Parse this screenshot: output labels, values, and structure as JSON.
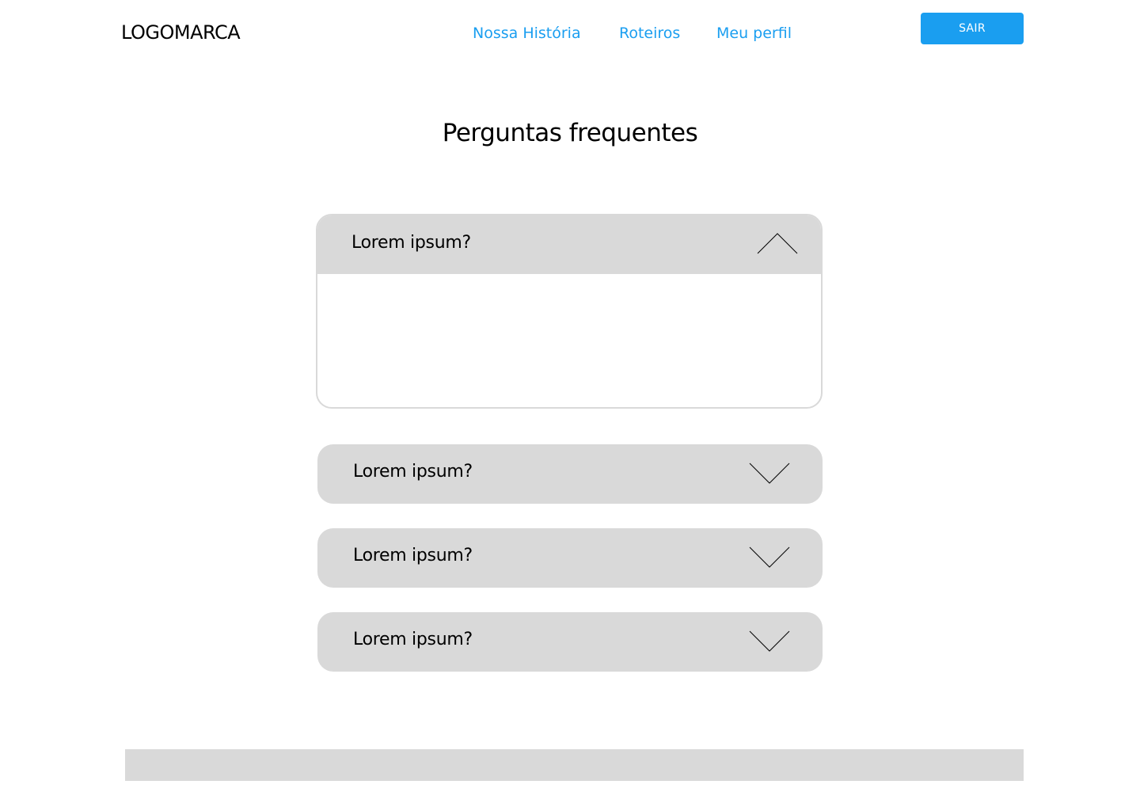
{
  "header": {
    "logo_text": "LOGOMARCA",
    "nav": [
      {
        "label": "Nossa História"
      },
      {
        "label": "Roteiros"
      },
      {
        "label": "Meu perfil"
      }
    ],
    "logout_label": "SAIR"
  },
  "main": {
    "title": "Perguntas frequentes",
    "faq": [
      {
        "question": "Lorem ipsum?",
        "expanded": true,
        "answer": "",
        "icon": "chevron-up-icon"
      },
      {
        "question": "Lorem ipsum?",
        "expanded": false,
        "icon": "chevron-down-icon"
      },
      {
        "question": "Lorem ipsum?",
        "expanded": false,
        "icon": "chevron-down-icon"
      },
      {
        "question": "Lorem ipsum?",
        "expanded": false,
        "icon": "chevron-down-icon"
      }
    ]
  },
  "colors": {
    "accent": "#1a9ef0",
    "panel": "#d9d9d9",
    "text": "#000000"
  }
}
